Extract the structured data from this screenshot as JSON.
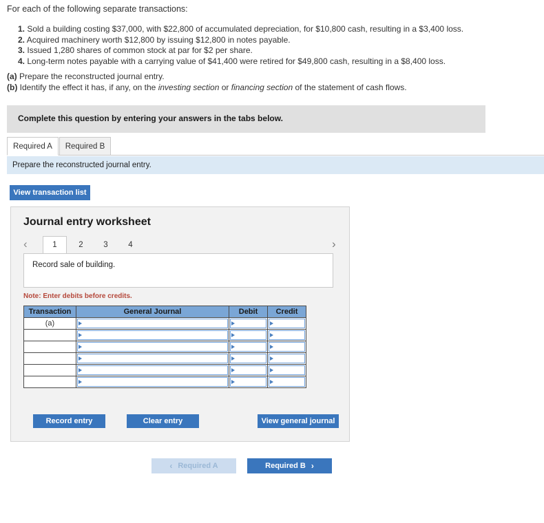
{
  "intro": "For each of the following separate transactions:",
  "transactions": [
    {
      "num": "1.",
      "text": "Sold a building costing $37,000, with $22,800 of accumulated depreciation, for $10,800 cash, resulting in a $3,400 loss."
    },
    {
      "num": "2.",
      "text": "Acquired machinery worth $12,800 by issuing $12,800 in notes payable."
    },
    {
      "num": "3.",
      "text": "Issued 1,280 shares of common stock at par for $2 per share."
    },
    {
      "num": "4.",
      "text": "Long-term notes payable with a carrying value of $41,400 were retired for $49,800 cash, resulting in a $8,400 loss."
    }
  ],
  "requirements": [
    {
      "tag": "(a)",
      "text": "Prepare the reconstructed journal entry."
    }
  ],
  "requirement_b": {
    "tag": "(b)",
    "part1": "Identify the effect it has, if any, on the ",
    "italic1": "investing section",
    "part2": " or ",
    "italic2": "financing section",
    "part3": " of the statement of cash flows."
  },
  "banner": {
    "text": "Complete this question by entering your answers in the tabs below."
  },
  "tabs": [
    {
      "label": "Required A",
      "active": true
    },
    {
      "label": "Required B",
      "active": false
    }
  ],
  "sub_instruction": "Prepare the reconstructed journal entry.",
  "buttons": {
    "view_transaction_list": "View transaction list",
    "record_entry": "Record entry",
    "clear_entry": "Clear entry",
    "view_general_journal": "View general journal"
  },
  "worksheet": {
    "title": "Journal entry worksheet",
    "pages": [
      "1",
      "2",
      "3",
      "4"
    ],
    "active_page": "1",
    "prev_icon": "chevron-left",
    "next_icon": "chevron-right",
    "prompt": "Record sale of building.",
    "note": "Note: Enter debits before credits."
  },
  "journal_table": {
    "headers": [
      "Transaction",
      "General Journal",
      "Debit",
      "Credit"
    ],
    "rows": [
      {
        "transaction": "(a)",
        "general_journal": "",
        "debit": "",
        "credit": ""
      },
      {
        "transaction": "",
        "general_journal": "",
        "debit": "",
        "credit": ""
      },
      {
        "transaction": "",
        "general_journal": "",
        "debit": "",
        "credit": ""
      },
      {
        "transaction": "",
        "general_journal": "",
        "debit": "",
        "credit": ""
      },
      {
        "transaction": "",
        "general_journal": "",
        "debit": "",
        "credit": ""
      },
      {
        "transaction": "",
        "general_journal": "",
        "debit": "",
        "credit": ""
      }
    ]
  },
  "bottom_nav": {
    "prev_label": "Required A",
    "next_label": "Required B",
    "prev_icon": "chevron-left",
    "next_icon": "chevron-right"
  },
  "colors": {
    "primary_blue": "#3a76bd",
    "table_header_blue": "#7aa6d6",
    "banner_gray": "#e0e0e0",
    "subinstruction_blue": "#dbe9f5",
    "note_red": "#b5483b",
    "panel_gray": "#f2f2f2",
    "disabled_blue": "#ccdcef"
  }
}
